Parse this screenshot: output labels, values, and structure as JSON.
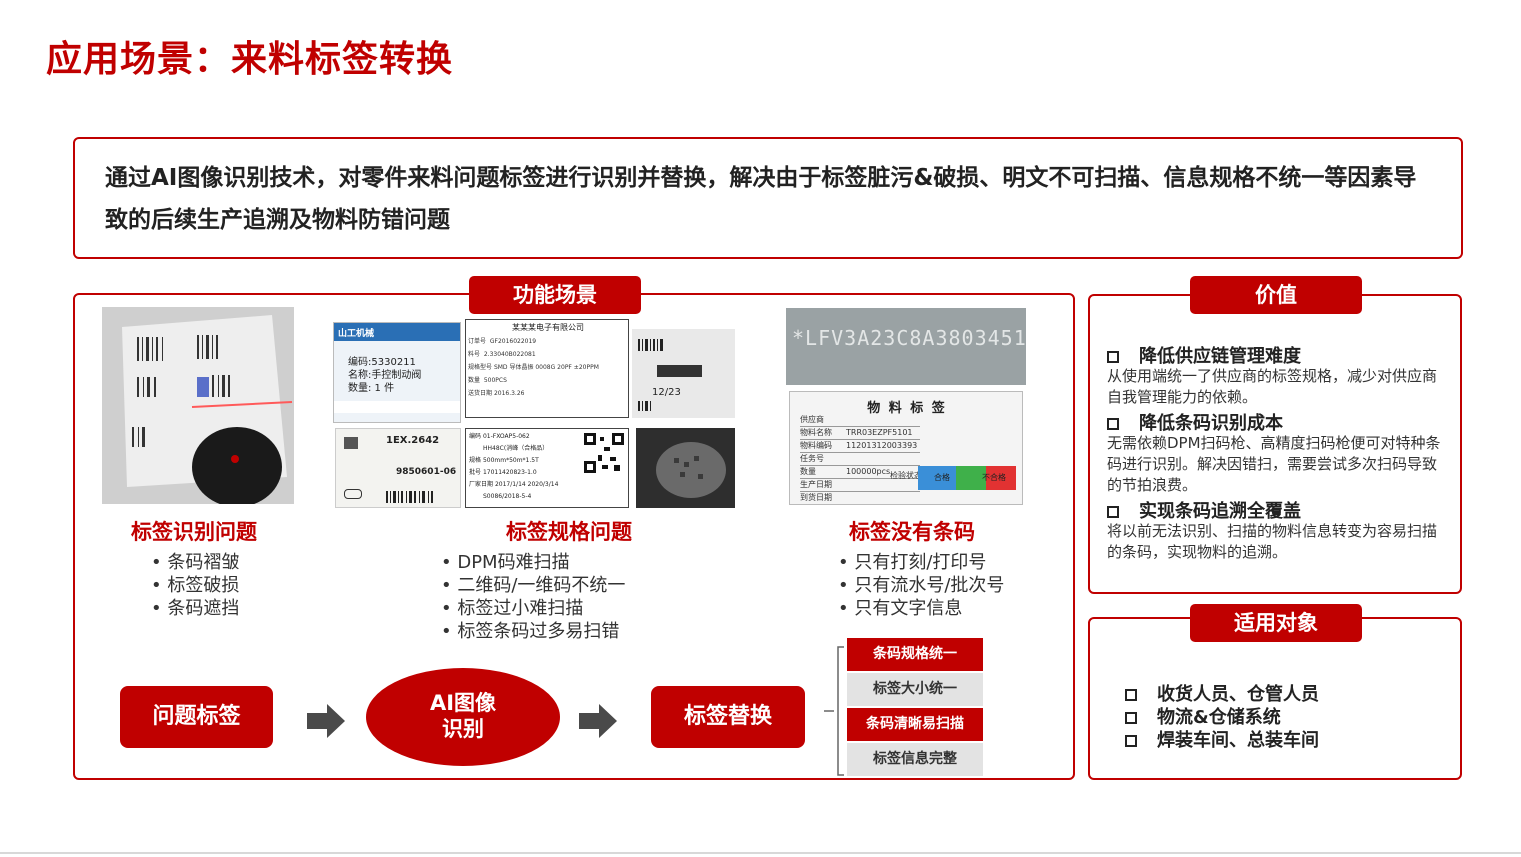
{
  "page": {
    "title": "应用场景：来料标签转换",
    "intro": "通过AI图像识别技术，对零件来料问题标签进行识别并替换，解决由于标签脏污&破损、明文不可扫描、信息规格不统一等因素导致的后续生产追溯及物料防错问题"
  },
  "function_section": {
    "badge": "功能场景",
    "columns": [
      {
        "title": "标签识别问题",
        "bullets": [
          "条码褶皱",
          "标签破损",
          "条码遮挡"
        ]
      },
      {
        "title": "标签规格问题",
        "bullets": [
          "DPM码难扫描",
          "二维码/一维码不统一",
          "标签过小难扫描",
          "标签条码过多易扫错"
        ]
      },
      {
        "title": "标签没有条码",
        "bullets": [
          "只有打刻/打印号",
          "只有流水号/批次号",
          "只有文字信息"
        ]
      }
    ],
    "images": {
      "label_company": "山工机械",
      "label_code": "编码:5330211",
      "label_name": "名称:手控制动阀",
      "label_qty": "数量: 1 件",
      "sheet_company": "某某某电子有限公司",
      "sheet_row1_label": "订单号",
      "sheet_row1_value": "GF2016022019",
      "sheet_row2_label": "料号",
      "sheet_row2_value": "2.33040B022081",
      "sheet_row3_label": "规格型号",
      "sheet_row3_value": "SMD 导体晶振 0008G 20PF ±20PPM",
      "sheet_row4_label": "数量",
      "sheet_row4_value": "500PCS",
      "sheet_row5_label": "送货日期",
      "sheet_row5_value": "2016.3.26",
      "sticker_code": "1EX.2642",
      "sticker_num": "9850601-06",
      "table_code_label": "编码",
      "table_code_value": "01-FXOAP5-062",
      "table_name": "HH48C(消峰（合格品）",
      "table_spec_label": "规格",
      "table_spec_value": "500mm*50m*1.5T",
      "table_batch_label": "批号",
      "table_batch_value": "17011420823-1.0",
      "table_date_label": "厂家日期",
      "table_date_value": "2017/1/14",
      "table_exp_value": "2020/3/14",
      "table_std": "S0086/2018-5-4",
      "print_date": "12/23",
      "engraved": "*LFV3A23C8A3803451*",
      "material_title": "物 料 标 签",
      "material_rows": [
        [
          "供应商",
          ""
        ],
        [
          "物料名称",
          "TRR03EZPF5101"
        ],
        [
          "物料编码",
          "11201312003393"
        ],
        [
          "任务号",
          ""
        ],
        [
          "数量",
          "100000pcs"
        ],
        [
          "生产日期",
          ""
        ],
        [
          "到货日期",
          ""
        ]
      ],
      "material_check": "检验状态",
      "material_pass": "合格",
      "material_fail": "不合格"
    }
  },
  "flow": {
    "step1": "问题标签",
    "step2_line1": "AI图像",
    "step2_line2": "识别",
    "step3": "标签替换",
    "results": [
      "条码规格统一",
      "标签大小统一",
      "条码清晰易扫描",
      "标签信息完整"
    ]
  },
  "value_section": {
    "badge": "价值",
    "items": [
      {
        "head": "降低供应链管理难度",
        "body": "从使用端统一了供应商的标签规格，减少对供应商自我管理能力的依赖。"
      },
      {
        "head": "降低条码识别成本",
        "body": "无需依赖DPM扫码枪、高精度扫码枪便可对特种条码进行识别。解决因错扫，需要尝试多次扫码导致的节拍浪费。"
      },
      {
        "head": "实现条码追溯全覆盖",
        "body": "将以前无法识别、扫描的物料信息转变为容易扫描的条码，实现物料的追溯。"
      }
    ]
  },
  "target_section": {
    "badge": "适用对象",
    "items": [
      "收货人员、仓管人员",
      "物流&仓储系统",
      "焊装车间、总装车间"
    ]
  },
  "colors": {
    "accent": "#c00000",
    "grey_item": "#e3e3e3"
  }
}
